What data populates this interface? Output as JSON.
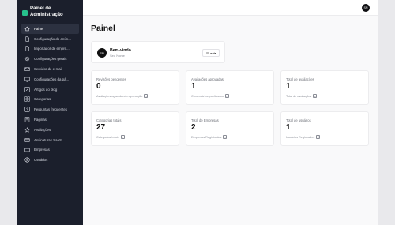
{
  "sidebar": {
    "brand": "Painel de Administração",
    "items": [
      {
        "label": "Painel",
        "icon": "home-icon",
        "active": true
      },
      {
        "label": "Configuração do anún...",
        "icon": "document-icon"
      },
      {
        "label": "Importador de empre...",
        "icon": "document-icon"
      },
      {
        "label": "Configurações gerais",
        "icon": "gear-icon"
      },
      {
        "label": "Servidor de e-mail",
        "icon": "mail-icon"
      },
      {
        "label": "Configurações da pá...",
        "icon": "monitor-icon"
      },
      {
        "label": "Artigos do blog",
        "icon": "pencil-icon"
      },
      {
        "label": "Categorias",
        "icon": "grid-icon"
      },
      {
        "label": "Perguntas frequentes",
        "icon": "question-icon"
      },
      {
        "label": "Páginas",
        "icon": "pages-icon"
      },
      {
        "label": "Avaliações",
        "icon": "star-icon"
      },
      {
        "label": "Assinaturas SaaS",
        "icon": "card-icon"
      },
      {
        "label": "Empresas",
        "icon": "briefcase-icon"
      },
      {
        "label": "Usuários",
        "icon": "user-icon"
      }
    ]
  },
  "topbar": {
    "avatar_initials": "SN"
  },
  "main": {
    "title": "Painel",
    "welcome": {
      "avatar_initials": "SN",
      "title": "Bem-vindo",
      "subtitle": "Seu Nome",
      "logout_label": "sair"
    },
    "cards": [
      {
        "label": "Revisões pendentes",
        "value": "0",
        "footer": "Avaliações aguardando aprovação"
      },
      {
        "label": "Avaliações aprovadas",
        "value": "1",
        "footer": "Comentários publicados"
      },
      {
        "label": "Total de avaliações",
        "value": "1",
        "footer": "Total de avaliações"
      },
      {
        "label": "Categorias totais",
        "value": "27",
        "footer": "Categorias totais"
      },
      {
        "label": "Total de Empresas",
        "value": "2",
        "footer": "Empresas Registradas"
      },
      {
        "label": "Total de usuários",
        "value": "1",
        "footer": "Usuários Registrados"
      }
    ]
  }
}
